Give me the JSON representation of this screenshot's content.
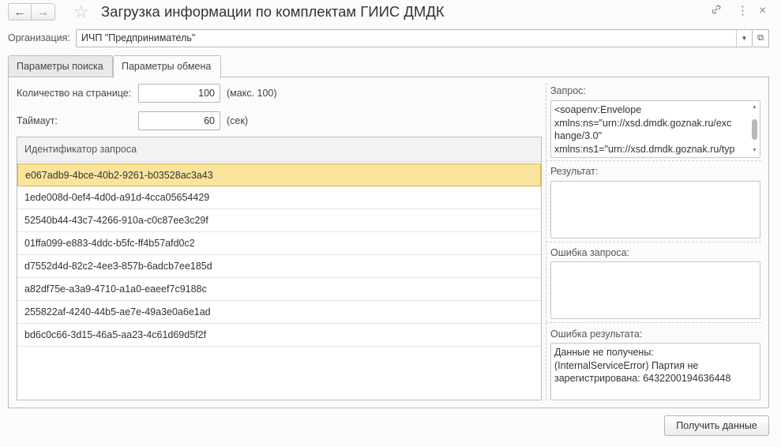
{
  "window": {
    "title": "Загрузка информации по комплектам ГИИС ДМДК",
    "nav": {
      "back_icon": "←",
      "forward_icon": "→"
    },
    "icons": {
      "favorite": "☆",
      "link": "🔗",
      "more": "⋮",
      "close": "×"
    }
  },
  "organization": {
    "label": "Организация:",
    "value": "ИЧП \"Предприниматель\"",
    "dropdown_icon": "▼",
    "open_icon": "⧉"
  },
  "tabs": [
    {
      "label": "Параметры поиска",
      "active": false
    },
    {
      "label": "Параметры обмена",
      "active": true
    }
  ],
  "params": {
    "per_page_label": "Количество на странице:",
    "per_page_value": "100",
    "per_page_hint": "(макс. 100)",
    "timeout_label": "Таймаут:",
    "timeout_value": "60",
    "timeout_hint": "(сек)"
  },
  "table": {
    "header": "Идентификатор запроса",
    "rows": [
      "e067adb9-4bce-40b2-9261-b03528ac3a43",
      "1ede008d-0ef4-4d0d-a91d-4cca05654429",
      "52540b44-43c7-4266-910a-c0c87ee3c29f",
      "01ffa099-e883-4ddc-b5fc-ff4b57afd0c2",
      "d7552d4d-82c2-4ee3-857b-6adcb7ee185d",
      "a82df75e-a3a9-4710-a1a0-eaeef7c9188c",
      "255822af-4240-44b5-ae7e-49a3e0a6e1ad",
      "bd6c0c66-3d15-46a5-aa23-4c61d69d5f2f"
    ],
    "selected_index": 0
  },
  "request": {
    "label": "Запрос:",
    "lines": [
      "<soapenv:Envelope",
      "xmlns:ns=\"urn://xsd.dmdk.goznak.ru/exc",
      "hange/3.0\"",
      "xmlns:ns1=\"urn://xsd.dmdk.goznak.ru/typ"
    ]
  },
  "result": {
    "label": "Результат:",
    "value": ""
  },
  "request_error": {
    "label": "Ошибка запроса:",
    "value": ""
  },
  "result_error": {
    "label": "Ошибка результата:",
    "lines": [
      "Данные не получены:",
      "(InternalServiceError) Партия не",
      "зарегистрирована: 6432200194636448"
    ]
  },
  "actions": {
    "get_data_label": "Получить данные"
  },
  "colors": {
    "selected_row": "#fbe49c",
    "selected_border": "#e0b341"
  }
}
